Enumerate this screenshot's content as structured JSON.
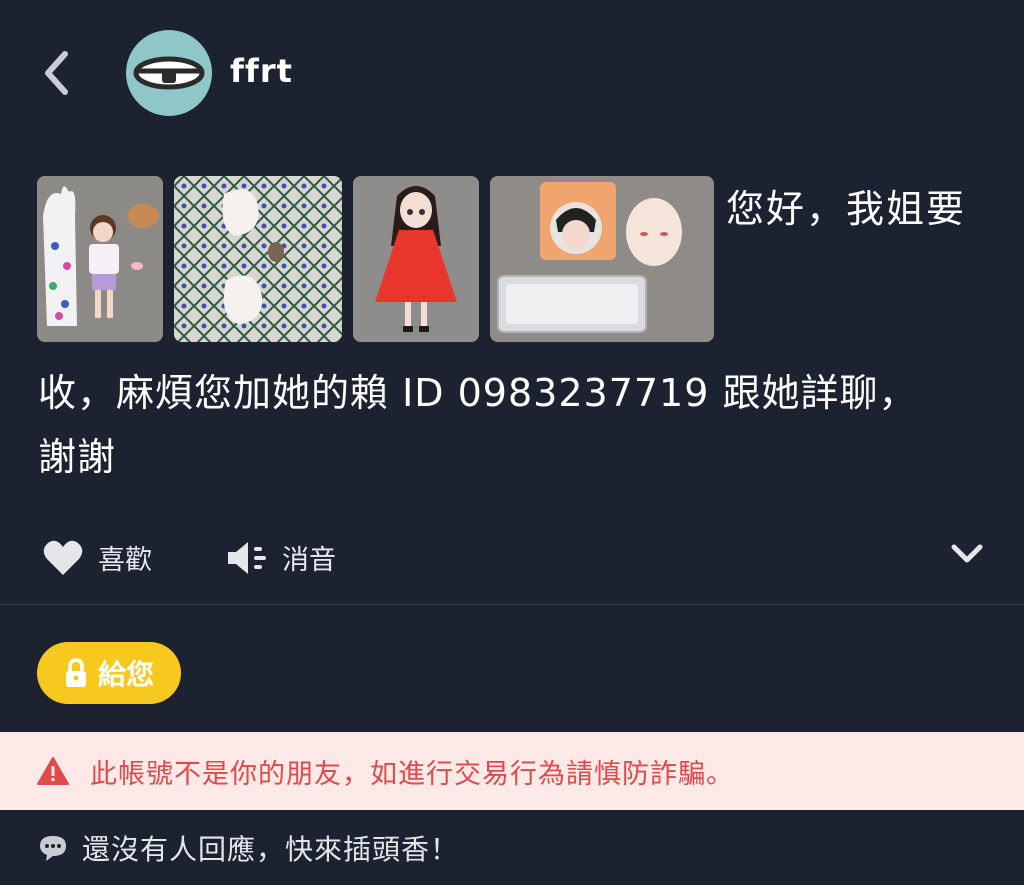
{
  "header": {
    "author": "ffrt"
  },
  "post": {
    "text_line1": "您好，我姐要",
    "text_line2": "收，麻煩您加她的賴 ID 0983237719 跟她詳聊，",
    "text_line3": "謝謝",
    "images": [
      "doll-outfit-photo",
      "doll-hands-photo",
      "doll-red-dress-photo",
      "doll-head-photo"
    ]
  },
  "actions": {
    "like_label": "喜歡",
    "mute_label": "消音"
  },
  "give": {
    "label": "給您"
  },
  "warning": {
    "text": "此帳號不是你的朋友，如進行交易行為請慎防詐騙。"
  },
  "comments": {
    "empty_text": "還沒有人回應，快來插頭香！"
  },
  "colors": {
    "background": "#1c2230",
    "give_button": "#f7c81e",
    "warning_bg": "#fce9e8",
    "warning_text": "#e04a4a",
    "avatar_bg": "#8fc6c7"
  }
}
